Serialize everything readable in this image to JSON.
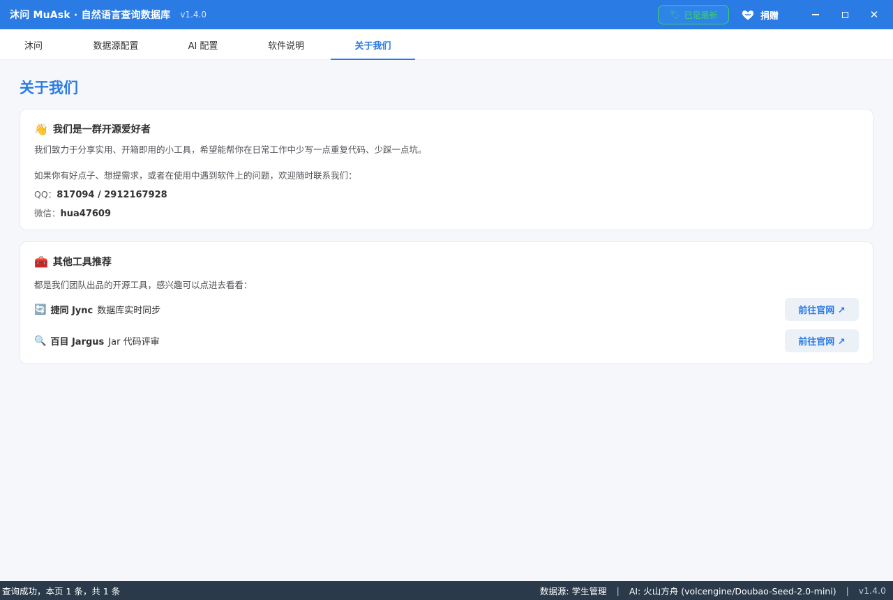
{
  "window": {
    "title": "沐问 MuAsk · 自然语言查询数据库",
    "version": "v1.4.0",
    "latest_badge": "已是最新",
    "donate_label": "捐赠"
  },
  "tabs": [
    {
      "label": "沐问"
    },
    {
      "label": "数据源配置"
    },
    {
      "label": "AI 配置"
    },
    {
      "label": "软件说明"
    },
    {
      "label": "关于我们",
      "active": true
    }
  ],
  "page": {
    "title": "关于我们"
  },
  "about_card": {
    "emoji": "👋",
    "title": "我们是一群开源爱好者",
    "intro": "我们致力于分享实用、开箱即用的小工具，希望能帮你在日常工作中少写一点重复代码、少踩一点坑。",
    "contact_prompt": "如果你有好点子、想提需求，或者在使用中遇到软件上的问题，欢迎随时联系我们：",
    "qq_label": "QQ：",
    "qq_value": "817094 / 2912167928",
    "wechat_label": "微信：",
    "wechat_value": "hua47609"
  },
  "tools_card": {
    "emoji": "🧰",
    "title": "其他工具推荐",
    "intro": "都是我们团队出品的开源工具，感兴趣可以点进去看看：",
    "tools": [
      {
        "icon": "🔄",
        "name": "捷同 Jync",
        "desc": "数据库实时同步",
        "button": "前往官网 ↗"
      },
      {
        "icon": "🔍",
        "name": "百目 Jargus",
        "desc": "Jar 代码评审",
        "button": "前往官网 ↗"
      }
    ]
  },
  "statusbar": {
    "left": "查询成功，本页 1 条，共 1 条",
    "datasource": "数据源: 学生管理",
    "ai": "AI: 火山方舟 (volcengine/Doubao-Seed-2.0-mini)",
    "separator": "|",
    "version": "v1.4.0"
  },
  "colors": {
    "accent": "#2a7be4",
    "success": "#3ecf6a",
    "statusbar": "#2b3a4a"
  }
}
